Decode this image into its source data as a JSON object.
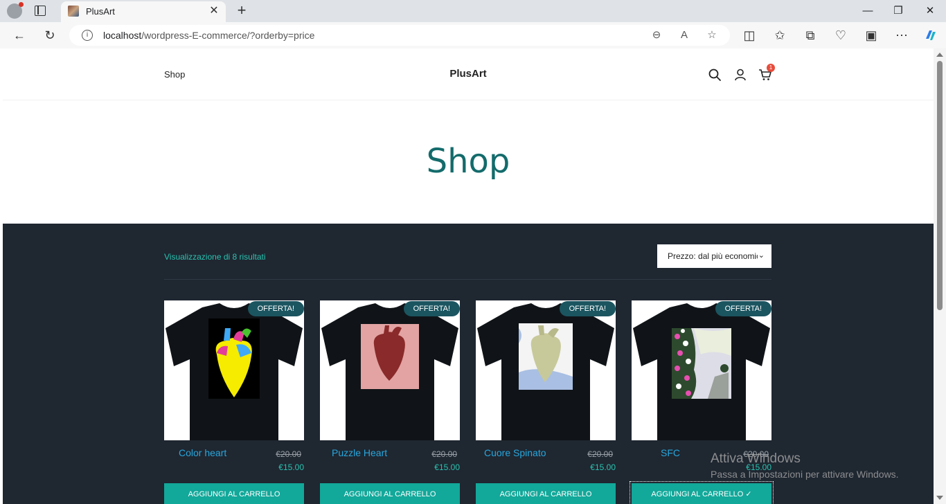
{
  "browser": {
    "tab_title": "PlusArt",
    "url_host": "localhost",
    "url_path": "/wordpress-E-commerce/?orderby=price"
  },
  "header": {
    "nav_shop": "Shop",
    "site_title": "PlusArt",
    "cart_count": "1"
  },
  "page": {
    "title": "Shop",
    "result_count": "Visualizzazione di 8 risultati",
    "orderby_value": "Prezzo: dal più economico"
  },
  "products": [
    {
      "name": "Color heart",
      "badge": "OFFERTA!",
      "price_old": "€20.00",
      "price_new": "€15.00",
      "button": "AGGIUNGI AL CARRELLO"
    },
    {
      "name": "Puzzle Heart",
      "badge": "OFFERTA!",
      "price_old": "€20.00",
      "price_new": "€15.00",
      "button": "AGGIUNGI AL CARRELLO"
    },
    {
      "name": "Cuore Spinato",
      "badge": "OFFERTA!",
      "price_old": "€20.00",
      "price_new": "€15.00",
      "button": "AGGIUNGI AL CARRELLO"
    },
    {
      "name": "SFC",
      "badge": "OFFERTA!",
      "price_old": "€20.00",
      "price_new": "€15.00",
      "button": "AGGIUNGI AL CARRELLO ✓"
    }
  ],
  "watermark": {
    "title": "Attiva Windows",
    "subtitle": "Passa a Impostazioni per attivare Windows."
  },
  "colors": {
    "accent": "#12a89a",
    "title": "#146b6b",
    "dark_bg": "#1f2731",
    "link": "#28a7dd"
  }
}
